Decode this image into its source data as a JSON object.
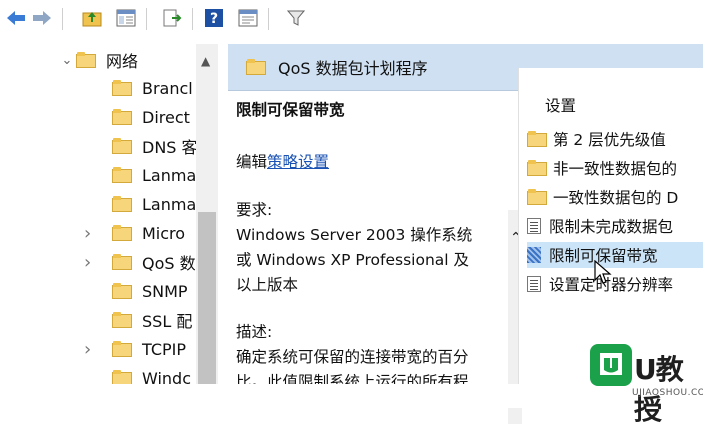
{
  "toolbar": {
    "icons": [
      "back-arrow-icon",
      "forward-arrow-icon",
      "up-folder-icon",
      "show-hide-tree-icon",
      "export-list-icon",
      "help-icon",
      "properties-icon",
      "filter-icon"
    ]
  },
  "tree": {
    "parent_label": "网络",
    "items": [
      {
        "label": "Brancl",
        "expandable": false
      },
      {
        "label": "Direct",
        "expandable": false
      },
      {
        "label": "DNS 客",
        "expandable": false
      },
      {
        "label": "Lanma",
        "expandable": false
      },
      {
        "label": "Lanma",
        "expandable": false
      },
      {
        "label": "Micro",
        "expandable": true
      },
      {
        "label": "QoS 数",
        "expandable": true
      },
      {
        "label": "SNMP",
        "expandable": false
      },
      {
        "label": "SSL 配",
        "expandable": false
      },
      {
        "label": "TCPIP",
        "expandable": true
      },
      {
        "label": "Windc",
        "expandable": false
      }
    ]
  },
  "header": {
    "title": "QoS 数据包计划程序"
  },
  "description": {
    "policy_title": "限制可保留带宽",
    "edit_prefix": "编辑",
    "edit_link": "策略设置",
    "requirements_label": "要求:",
    "requirements_lines": [
      "Windows Server 2003 操作系统",
      "或 Windows XP Professional 及",
      "以上版本"
    ],
    "description_label": "描述:",
    "description_lines": [
      "确定系统可保留的连接带宽的百分",
      "比。此值限制系统上运行的所有程"
    ]
  },
  "settings": {
    "header": "设置",
    "items": [
      {
        "label": "第 2 层优先级值",
        "type": "folder"
      },
      {
        "label": "非一致性数据包的",
        "type": "folder"
      },
      {
        "label": "一致性数据包的 D",
        "type": "folder"
      },
      {
        "label": "限制未完成数据包",
        "type": "policy"
      },
      {
        "label": "限制可保留带宽",
        "type": "policy-selected"
      },
      {
        "label": "设置定时器分辨率",
        "type": "policy"
      }
    ]
  },
  "watermark": {
    "brand": "U教授",
    "url": "UJIAOSHOU.COM"
  },
  "colors": {
    "header_bg": "#cfe0f2",
    "selection": "#cce4f7",
    "link": "#1a52b3",
    "folder": "#f7d57a",
    "logo_green": "#1aa14a"
  }
}
